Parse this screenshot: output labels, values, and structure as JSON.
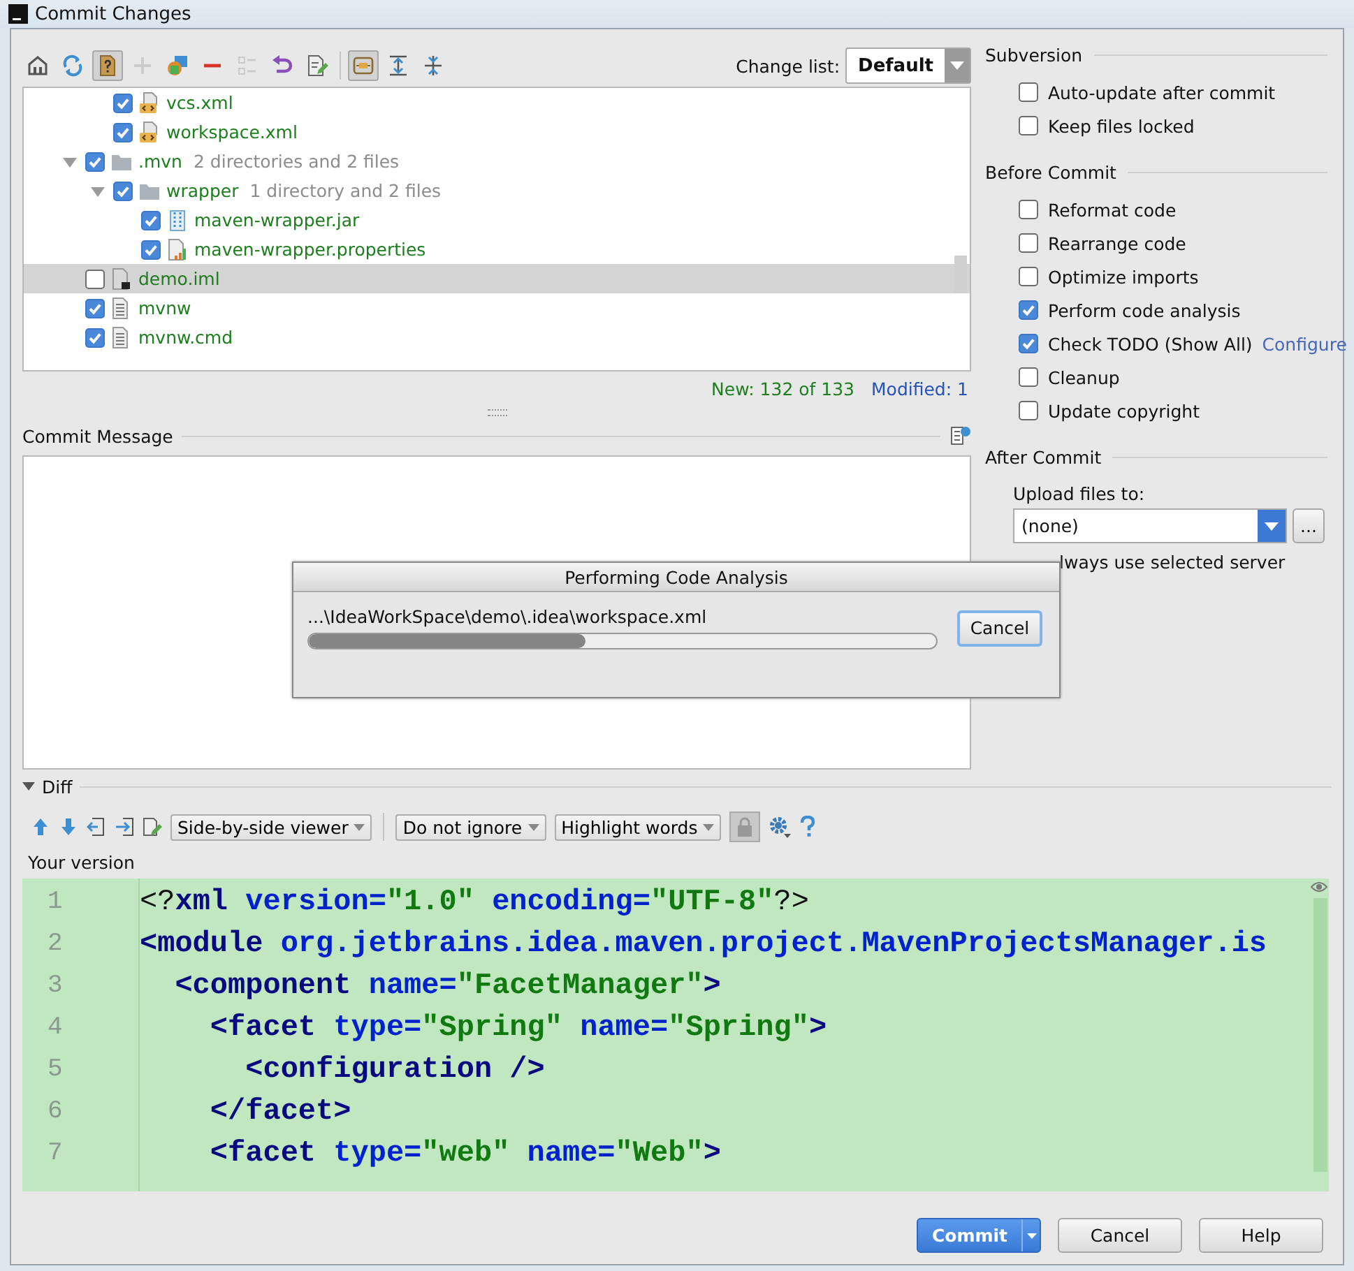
{
  "window": {
    "title": "Commit Changes"
  },
  "toolbar": [
    {
      "pressed": false,
      "disabled": false
    },
    {
      "pressed": false,
      "disabled": false
    },
    {
      "pressed": true,
      "disabled": false
    },
    {
      "pressed": false,
      "disabled": true
    },
    {
      "pressed": false,
      "disabled": false
    },
    {
      "pressed": false,
      "disabled": false
    },
    {
      "pressed": false,
      "disabled": true
    },
    {
      "pressed": false,
      "disabled": false
    },
    {
      "pressed": false,
      "disabled": false
    },
    {
      "pressed": true,
      "disabled": false
    },
    {
      "pressed": false,
      "disabled": false
    },
    {
      "pressed": false,
      "disabled": false
    }
  ],
  "change_list": {
    "label": "Change list:",
    "value": "Default"
  },
  "tree": {
    "items": [
      {
        "children": [
          {
            "name": "vcs.xml",
            "kind": "xml",
            "checked": true,
            "selected": false
          },
          {
            "name": "workspace.xml",
            "kind": "xml",
            "checked": true,
            "selected": false
          }
        ]
      },
      {
        "name": ".mvn",
        "note": "2 directories and 2 files",
        "kind": "folder",
        "checked": true,
        "selected": false,
        "expanded": true,
        "children": [
          {
            "name": "wrapper",
            "note": "1 directory and 2 files",
            "kind": "folder",
            "checked": true,
            "selected": false,
            "expanded": true,
            "children": [
              {
                "name": "maven-wrapper.jar",
                "kind": "jar",
                "checked": true,
                "selected": false
              },
              {
                "name": "maven-wrapper.properties",
                "kind": "properties",
                "checked": true,
                "selected": false
              }
            ]
          }
        ]
      },
      {
        "name": "demo.iml",
        "kind": "iml",
        "checked": false,
        "selected": true
      },
      {
        "name": "mvnw",
        "kind": "text",
        "checked": true,
        "selected": false
      },
      {
        "name": "mvnw.cmd",
        "kind": "text",
        "checked": true,
        "selected": false
      }
    ]
  },
  "counts": {
    "new": "New: 132 of 133",
    "modified": "Modified: 1"
  },
  "commit_message": {
    "label": "Commit Message"
  },
  "subversion": {
    "title": "Subversion",
    "options": [
      {
        "label": "Auto-update after commit",
        "checked": false
      },
      {
        "label": "Keep files locked",
        "checked": false
      }
    ]
  },
  "before_commit": {
    "title": "Before Commit",
    "options": [
      {
        "label": "Reformat code",
        "checked": false
      },
      {
        "label": "Rearrange code",
        "checked": false
      },
      {
        "label": "Optimize imports",
        "checked": false
      },
      {
        "label": "Perform code analysis",
        "checked": true
      },
      {
        "label": "Check TODO (Show All)",
        "checked": true,
        "link": "Configure"
      },
      {
        "label": "Cleanup",
        "checked": false
      },
      {
        "label": "Update copyright",
        "checked": false
      }
    ]
  },
  "after_commit": {
    "title": "After Commit",
    "upload_label": "Upload files to:",
    "upload_value": "(none)",
    "browse": "...",
    "always_label": "lways use selected server"
  },
  "progress_dialog": {
    "title": "Performing Code Analysis",
    "path": "...\\IdeaWorkSpace\\demo\\.idea\\workspace.xml",
    "level": 0.44,
    "cancel": "Cancel"
  },
  "diff": {
    "title": "Diff",
    "expanded": true,
    "viewer": "Side-by-side viewer",
    "ignore": "Do not ignore",
    "highlight": "Highlight words",
    "side_label": "Your version",
    "lines": [
      {
        "number": "1",
        "tokens": [
          {
            "kind": "plain",
            "text": "<?"
          },
          {
            "kind": "tag",
            "text": "xml"
          },
          {
            "kind": "attr",
            "text": " version="
          },
          {
            "kind": "value",
            "text": "\"1.0\""
          },
          {
            "kind": "attr",
            "text": " encoding="
          },
          {
            "kind": "value",
            "text": "\"UTF-8\""
          },
          {
            "kind": "plain",
            "text": "?>"
          }
        ]
      },
      {
        "number": "2",
        "tokens": [
          {
            "kind": "tag",
            "text": "<module"
          },
          {
            "kind": "attr",
            "text": " org.jetbrains.idea.maven.project.MavenProjectsManager.is"
          }
        ]
      },
      {
        "number": "3",
        "tokens": [
          {
            "kind": "tag",
            "text": "  <component"
          },
          {
            "kind": "attr",
            "text": " name="
          },
          {
            "kind": "value",
            "text": "\"FacetManager\""
          },
          {
            "kind": "tag",
            "text": ">"
          }
        ]
      },
      {
        "number": "4",
        "tokens": [
          {
            "kind": "tag",
            "text": "    <facet"
          },
          {
            "kind": "attr",
            "text": " type="
          },
          {
            "kind": "value",
            "text": "\"Spring\""
          },
          {
            "kind": "attr",
            "text": " name="
          },
          {
            "kind": "value",
            "text": "\"Spring\""
          },
          {
            "kind": "tag",
            "text": ">"
          }
        ]
      },
      {
        "number": "5",
        "tokens": [
          {
            "kind": "tag",
            "text": "      <configuration />"
          }
        ]
      },
      {
        "number": "6",
        "tokens": [
          {
            "kind": "tag",
            "text": "    </facet>"
          }
        ]
      },
      {
        "number": "7",
        "tokens": [
          {
            "kind": "tag",
            "text": "    <facet"
          },
          {
            "kind": "attr",
            "text": " type="
          },
          {
            "kind": "value",
            "text": "\"web\""
          },
          {
            "kind": "attr",
            "text": " name="
          },
          {
            "kind": "value",
            "text": "\"Web\""
          },
          {
            "kind": "tag",
            "text": ">"
          }
        ]
      }
    ]
  },
  "buttons": [
    {
      "label": "Commit",
      "kind": "primary"
    },
    {
      "label": "Cancel",
      "kind": "normal"
    },
    {
      "label": "Help",
      "kind": "normal"
    }
  ]
}
